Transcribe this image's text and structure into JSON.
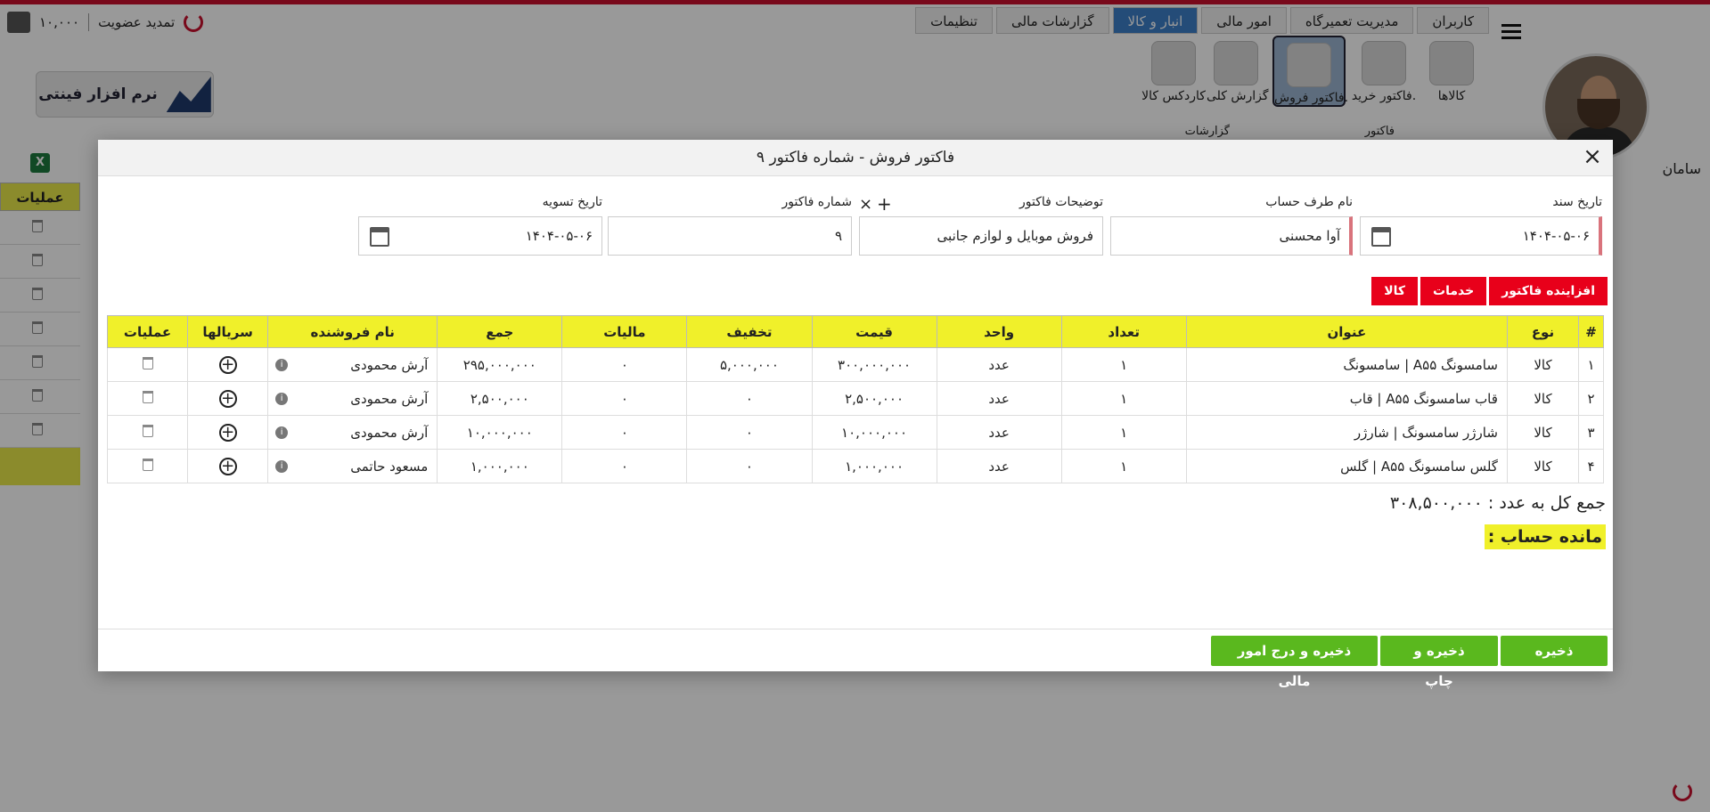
{
  "app": {
    "membership": "تمدید عضویت",
    "credit": "۱۰,۰۰۰",
    "user_name": "سامان",
    "logo_text": "نرم افزار فینتی"
  },
  "tabs": [
    {
      "label": "کاربران",
      "active": false
    },
    {
      "label": "مدیریت تعمیرگاه",
      "active": false
    },
    {
      "label": "امور مالی",
      "active": false
    },
    {
      "label": "انبار و کالا",
      "active": true
    },
    {
      "label": "گزارشات مالی",
      "active": false
    },
    {
      "label": "تنظیمات",
      "active": false
    }
  ],
  "ribbon": {
    "items": [
      {
        "label": "کالاها",
        "icon": "product-check-icon"
      },
      {
        "label": "فاکتور خرید.",
        "icon": "purchase-invoice-icon"
      },
      {
        "label": "فاکتور فروش.",
        "icon": "sales-basket-icon"
      },
      {
        "label": "گزارش کلی",
        "icon": "report-icon"
      },
      {
        "label": "کاردکس کالا",
        "icon": "cardex-icon"
      }
    ],
    "group_invoice": "فاکتور",
    "group_reports": "گزارشات"
  },
  "background_table": {
    "header": "عملیات",
    "rows": 7
  },
  "modal": {
    "title": "فاکتور فروش - شماره فاکتور ۹",
    "fields": {
      "doc_date_label": "تاریخ سند",
      "doc_date_value": "۱۴۰۴-۰۵-۰۶",
      "account_label": "نام طرف حساب",
      "account_value": "آوا محسنی",
      "desc_label": "توضیحات فاکتور",
      "desc_value": "فروش موبایل و لوازم جانبی",
      "number_label": "شماره فاکتور",
      "number_value": "۹",
      "settle_label": "تاریخ تسویه",
      "settle_value": "۱۴۰۴-۰۵-۰۶"
    },
    "type_tabs": [
      "کالا",
      "خدمات",
      "افزاینده فاکتور"
    ],
    "columns": [
      "#",
      "نوع",
      "عنوان",
      "تعداد",
      "واحد",
      "قیمت",
      "تخفیف",
      "مالیات",
      "جمع",
      "نام فروشنده",
      "سریالها",
      "عملیات"
    ],
    "rows": [
      {
        "n": "۱",
        "type": "کالا",
        "title": "سامسونگ A۵۵ | سامسونگ",
        "qty": "۱",
        "unit": "عدد",
        "price": "۳۰۰,۰۰۰,۰۰۰",
        "discount": "۵,۰۰۰,۰۰۰",
        "tax": "۰",
        "sum": "۲۹۵,۰۰۰,۰۰۰",
        "seller": "آرش محمودی"
      },
      {
        "n": "۲",
        "type": "کالا",
        "title": "قاب سامسونگ A۵۵ | قاب",
        "qty": "۱",
        "unit": "عدد",
        "price": "۲,۵۰۰,۰۰۰",
        "discount": "۰",
        "tax": "۰",
        "sum": "۲,۵۰۰,۰۰۰",
        "seller": "آرش محمودی"
      },
      {
        "n": "۳",
        "type": "کالا",
        "title": "شارژر سامسونگ | شارژر",
        "qty": "۱",
        "unit": "عدد",
        "price": "۱۰,۰۰۰,۰۰۰",
        "discount": "۰",
        "tax": "۰",
        "sum": "۱۰,۰۰۰,۰۰۰",
        "seller": "آرش محمودی"
      },
      {
        "n": "۴",
        "type": "کالا",
        "title": "گلس سامسونگ A۵۵ | گلس",
        "qty": "۱",
        "unit": "عدد",
        "price": "۱,۰۰۰,۰۰۰",
        "discount": "۰",
        "tax": "۰",
        "sum": "۱,۰۰۰,۰۰۰",
        "seller": "مسعود حاتمی"
      }
    ],
    "total_label": "جمع کل به عدد :",
    "total_value": "۳۰۸,۵۰۰,۰۰۰",
    "balance_label": "مانده حساب :",
    "buttons": {
      "save": "ذخیره",
      "save_print": "ذخیره و چاپ",
      "save_finance": "ذخیره و درج امور مالی"
    }
  }
}
